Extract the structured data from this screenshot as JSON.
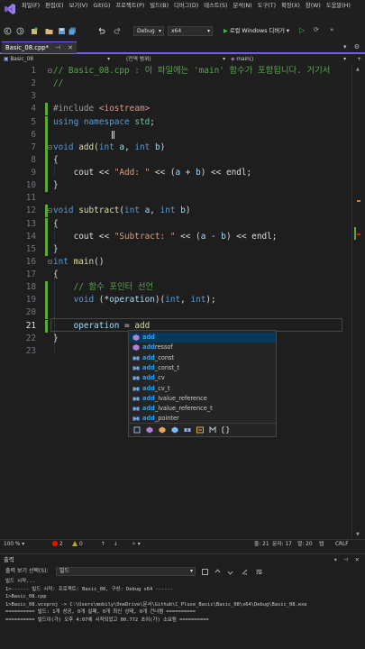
{
  "menubar": {
    "items": [
      "파일(F)",
      "편집(E)",
      "보기(V)",
      "Git(G)",
      "프로젝트(P)",
      "빌드(B)",
      "디버그(D)",
      "테스트(S)",
      "분석(N)",
      "도구(T)",
      "확장(X)",
      "창(W)",
      "도움말(H)"
    ]
  },
  "toolbar": {
    "config": "Debug",
    "platform": "x64",
    "run_label": "로컬 Windows 디버거"
  },
  "tabs": [
    {
      "label": "Basic_08.cpp*",
      "active": true
    }
  ],
  "navbar": {
    "project": "Basic_08",
    "scope": "(전역 범위)",
    "member": "main()"
  },
  "editor": {
    "current_line": 21,
    "lines": [
      {
        "n": "1",
        "text": "// Basic_08.cpp : 이 파일에는 'main' 함수가 포함됩니다. 거기서"
      },
      {
        "n": "2",
        "text": "//"
      },
      {
        "n": "3",
        "text": ""
      },
      {
        "n": "4",
        "text": "#include <iostream>"
      },
      {
        "n": "5",
        "text": "using namespace std;"
      },
      {
        "n": "6",
        "text": ""
      },
      {
        "n": "7",
        "text": "void add(int a, int b)"
      },
      {
        "n": "8",
        "text": "{"
      },
      {
        "n": "9",
        "text": "    cout << \"Add: \" << (a + b) << endl;"
      },
      {
        "n": "10",
        "text": "}"
      },
      {
        "n": "11",
        "text": ""
      },
      {
        "n": "12",
        "text": "void subtract(int a, int b)"
      },
      {
        "n": "13",
        "text": "{"
      },
      {
        "n": "14",
        "text": "    cout << \"Subtract: \" << (a - b) << endl;"
      },
      {
        "n": "15",
        "text": "}"
      },
      {
        "n": "16",
        "text": "int main()"
      },
      {
        "n": "17",
        "text": "{"
      },
      {
        "n": "18",
        "text": "    // 함수 포인터 선언"
      },
      {
        "n": "19",
        "text": "    void (*operation)(int, int);"
      },
      {
        "n": "20",
        "text": ""
      },
      {
        "n": "21",
        "text": "    operation = add"
      },
      {
        "n": "22",
        "text": "}"
      },
      {
        "n": "23",
        "text": ""
      }
    ]
  },
  "autocomplete": {
    "items": [
      {
        "match": "add",
        "rest": "",
        "icon": "function-icon"
      },
      {
        "match": "add",
        "rest": "ressof",
        "icon": "function-icon"
      },
      {
        "match": "add",
        "rest": "_const",
        "icon": "type-icon"
      },
      {
        "match": "add",
        "rest": "_const_t",
        "icon": "type-icon"
      },
      {
        "match": "add",
        "rest": "_cv",
        "icon": "type-icon"
      },
      {
        "match": "add",
        "rest": "_cv_t",
        "icon": "type-icon"
      },
      {
        "match": "add",
        "rest": "_lvalue_reference",
        "icon": "type-icon"
      },
      {
        "match": "add",
        "rest": "_lvalue_reference_t",
        "icon": "type-icon"
      },
      {
        "match": "add",
        "rest": "_pointer",
        "icon": "type-icon"
      }
    ]
  },
  "status": {
    "zoom": "100 %",
    "errors": "2",
    "warnings": "0",
    "line": "줄: 21",
    "col": "문자: 17",
    "spc": "열: 20",
    "ins": "탭",
    "eol": "CRLF"
  },
  "output": {
    "title": "출력",
    "source_label": "출력 보기 선택(S):",
    "source_value": "빌드",
    "lines": [
      "빌드 시작...",
      "1>------ 빌드 시작: 프로젝트: Basic_08, 구성: Debug x64 ------",
      "1>Basic_08.cpp",
      "1>Basic_08.vcxproj -> C:\\Users\\mobily\\OneDrive\\문서\\Github\\C_Pluse_Basic\\Basic_08\\x64\\Debug\\Basic_08.exe",
      "========== 빌드: 1개 성공, 0개 실패, 0개 최신 상태, 0개 건너뜀 ==========",
      "========== 빌드이(가) 오후 4:07에 시작되었고 00.772 초이(가) 소요됨 =========="
    ]
  },
  "colors": {
    "accent": "#7160e8",
    "changebar": "#5aa83a",
    "ac_match": "#18a3ff",
    "error": "#e51400"
  }
}
